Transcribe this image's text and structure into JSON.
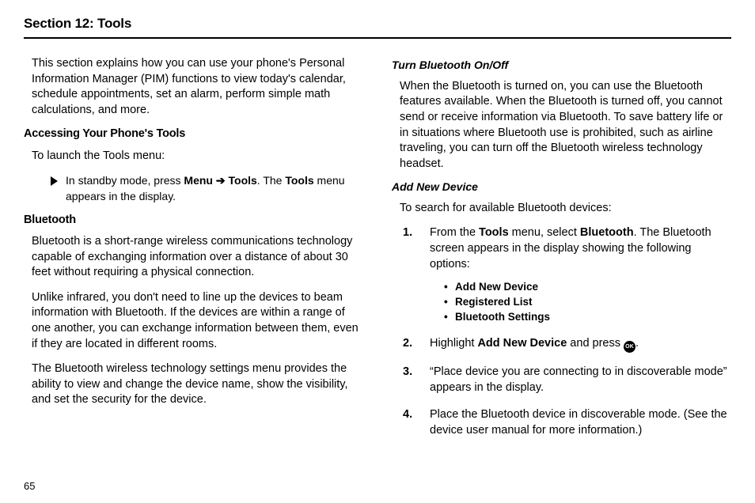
{
  "section": {
    "title": "Section 12: Tools"
  },
  "left": {
    "intro": "This section explains how you can use your phone's Personal Information Manager (PIM) functions to view today's calendar, schedule appointments, set an alarm, perform simple math calculations, and more.",
    "h_accessing": "Accessing Your Phone's Tools",
    "launch_text": "To launch the Tools menu:",
    "step_pre": "In standby mode, press ",
    "step_menu": "Menu",
    "step_arrow": "➔",
    "step_tools": "Tools",
    "step_mid": ". The ",
    "step_tools2": "Tools",
    "step_post": " menu appears in the display.",
    "h_bluetooth": "Bluetooth",
    "bt_p1": "Bluetooth is a short-range wireless communications technology capable of exchanging information over a distance of about 30 feet without requiring a physical connection.",
    "bt_p2": "Unlike infrared, you don't need to line up the devices to beam information with Bluetooth. If the devices are within a range of one another, you can exchange information between them, even if they are located in different rooms.",
    "bt_p3": "The Bluetooth wireless technology settings menu provides the ability to view and change the device name, show the visibility, and set the security for the device."
  },
  "right": {
    "h_onoff": "Turn Bluetooth On/Off",
    "onoff_p": "When the Bluetooth is turned on, you can use the Bluetooth features available. When the Bluetooth is turned off, you cannot send or receive information via Bluetooth. To save battery life or in situations where Bluetooth use is prohibited, such as airline traveling, you can turn off the Bluetooth wireless technology headset.",
    "h_add": "Add New Device",
    "add_intro": "To search for available Bluetooth devices:",
    "s1_pre": "From the ",
    "s1_tools": "Tools",
    "s1_mid": " menu, select ",
    "s1_bt": "Bluetooth",
    "s1_post": ". The Bluetooth screen appears in the display showing the following options:",
    "opt1": "Add New Device",
    "opt2": "Registered List",
    "opt3": "Bluetooth Settings",
    "s2_pre": "Highlight ",
    "s2_add": "Add New Device",
    "s2_mid": " and press ",
    "ok": "OK",
    "s2_post": ".",
    "s3": "“Place device you are connecting to in discoverable mode” appears in the display.",
    "s4": "Place the Bluetooth device in discoverable mode. (See the device user manual for more information.)"
  },
  "page": "65"
}
